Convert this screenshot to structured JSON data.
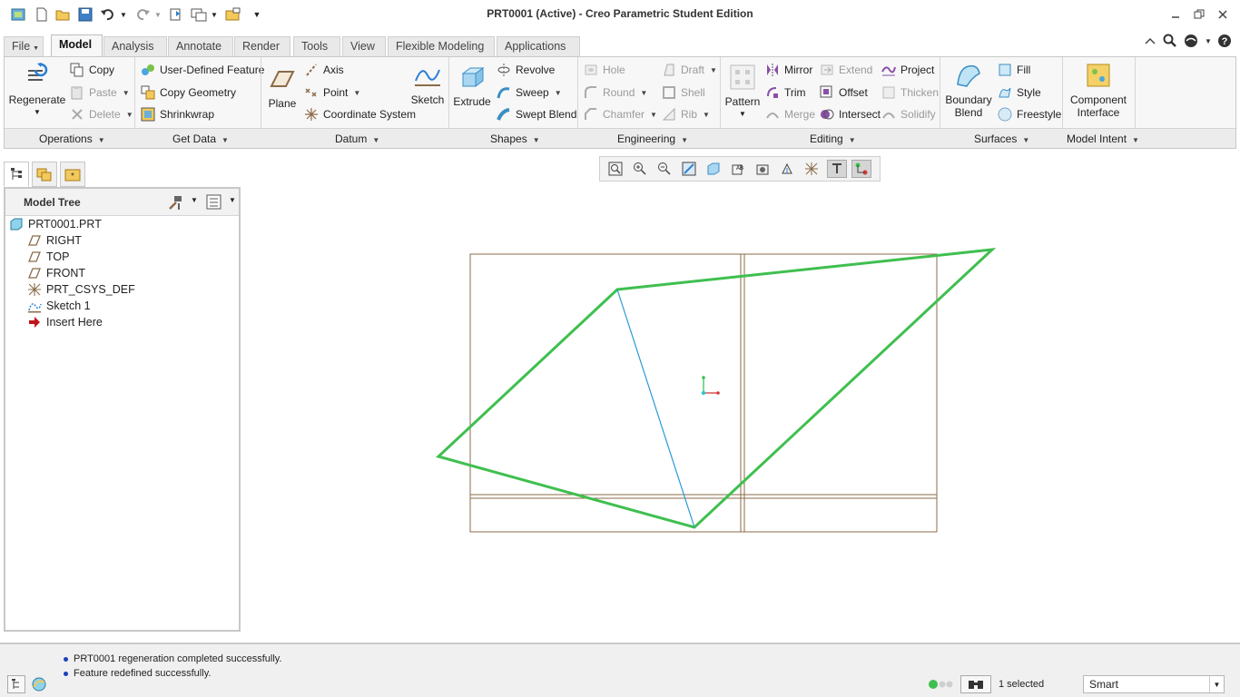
{
  "window": {
    "title": "PRT0001 (Active) - Creo Parametric Student Edition",
    "controls": [
      "minimize-icon",
      "restore-icon",
      "close-icon"
    ]
  },
  "quick_access": [
    "app-icon",
    "new-icon",
    "open-icon",
    "save-icon",
    "undo-icon",
    "redo-icon",
    "regenerate-icon",
    "windows-icon",
    "close-window-icon",
    "customize-icon"
  ],
  "tabs": [
    {
      "label": "File",
      "active": false
    },
    {
      "label": "Model",
      "active": true
    },
    {
      "label": "Analysis",
      "active": false
    },
    {
      "label": "Annotate",
      "active": false
    },
    {
      "label": "Render",
      "active": false
    },
    {
      "label": "Tools",
      "active": false
    },
    {
      "label": "View",
      "active": false
    },
    {
      "label": "Flexible Modeling",
      "active": false
    },
    {
      "label": "Applications",
      "active": false
    }
  ],
  "ribbon": {
    "operations": {
      "regenerate": "Regenerate",
      "copy": "Copy",
      "paste": "Paste",
      "delete": "Delete"
    },
    "get_data": {
      "udf": "User-Defined Feature",
      "copy_geometry": "Copy Geometry",
      "shrinkwrap": "Shrinkwrap"
    },
    "datum": {
      "plane": "Plane",
      "axis": "Axis",
      "point": "Point",
      "csys": "Coordinate System",
      "sketch": "Sketch"
    },
    "shapes": {
      "extrude": "Extrude",
      "revolve": "Revolve",
      "sweep": "Sweep",
      "swept_blend": "Swept Blend"
    },
    "engineering": {
      "hole": "Hole",
      "round": "Round",
      "chamfer": "Chamfer",
      "draft": "Draft",
      "shell": "Shell",
      "rib": "Rib"
    },
    "editing": {
      "pattern": "Pattern",
      "mirror": "Mirror",
      "trim": "Trim",
      "merge": "Merge",
      "extend": "Extend",
      "offset": "Offset",
      "intersect": "Intersect",
      "project": "Project",
      "thicken": "Thicken",
      "solidify": "Solidify"
    },
    "surfaces": {
      "boundary_blend_1": "Boundary",
      "boundary_blend_2": "Blend",
      "fill": "Fill",
      "style": "Style",
      "freestyle": "Freestyle"
    },
    "model_intent": {
      "component_interface_1": "Component",
      "component_interface_2": "Interface"
    },
    "groups": [
      "Operations",
      "Get Data",
      "Datum",
      "Shapes",
      "Engineering",
      "Editing",
      "Surfaces",
      "Model Intent"
    ]
  },
  "model_tree": {
    "title": "Model Tree",
    "items": [
      {
        "label": "PRT0001.PRT",
        "icon": "part-icon"
      },
      {
        "label": "RIGHT",
        "icon": "datum-plane-icon"
      },
      {
        "label": "TOP",
        "icon": "datum-plane-icon"
      },
      {
        "label": "FRONT",
        "icon": "datum-plane-icon"
      },
      {
        "label": "PRT_CSYS_DEF",
        "icon": "csys-icon"
      },
      {
        "label": "Sketch 1",
        "icon": "sketch-icon"
      },
      {
        "label": "Insert Here",
        "icon": "insert-arrow-icon"
      }
    ]
  },
  "colors": {
    "datum_plane": "#8b6b4a",
    "sketch_highlight": "#3fbf4f",
    "sketch_line": "#2a9ad6",
    "accent": "#1a3fbf"
  },
  "status": {
    "messages": [
      "PRT0001 regeneration completed successfully.",
      "Feature redefined successfully."
    ],
    "selected": "1 selected",
    "filter": "Smart"
  }
}
